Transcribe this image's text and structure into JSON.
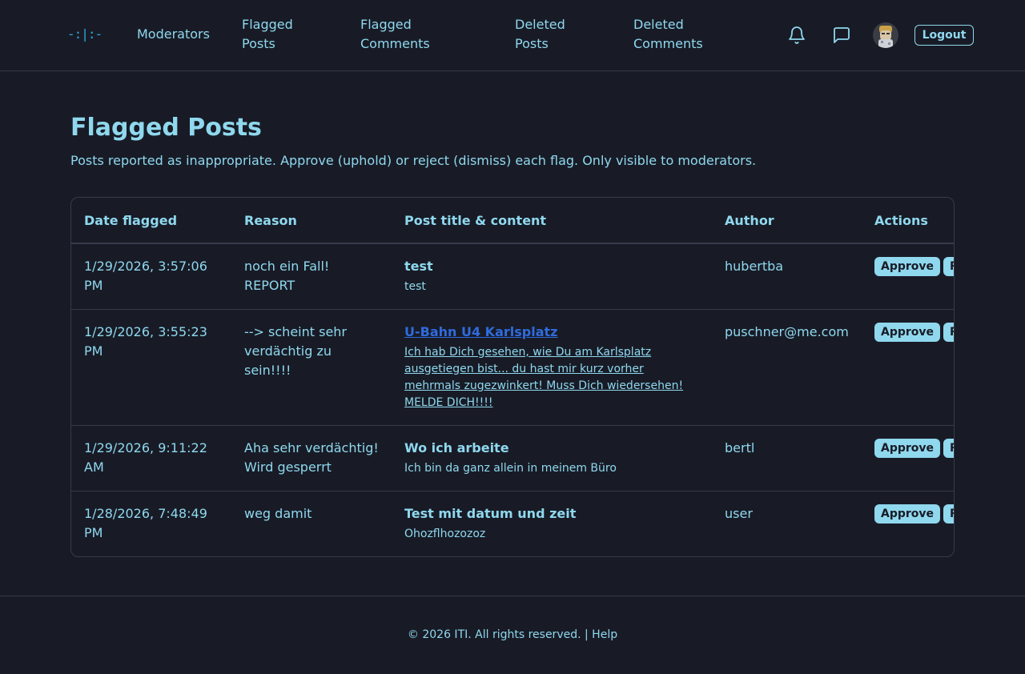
{
  "header": {
    "logo": "-:|:-",
    "nav": {
      "moderators": "Moderators",
      "flagged_posts": "Flagged Posts",
      "flagged_comments": "Flagged Comments",
      "deleted_posts": "Deleted Posts",
      "deleted_comments": "Deleted Comments"
    },
    "icons": {
      "notifications": "bell-icon",
      "messages": "chat-icon"
    },
    "logout_label": "Logout"
  },
  "main": {
    "title": "Flagged Posts",
    "description": "Posts reported as inappropriate. Approve (uphold) or reject (dismiss) each flag. Only visible to moderators.",
    "columns": {
      "date": "Date flagged",
      "reason": "Reason",
      "post": "Post title & content",
      "author": "Author",
      "actions": "Actions"
    },
    "rows": [
      {
        "date": "1/29/2026, 3:57:06 PM",
        "reason": "noch ein Fall! REPORT",
        "post_title": "test",
        "post_content": "test",
        "author": "hubertba",
        "approve_label": "Approve",
        "reject_label": "Reject"
      },
      {
        "date": "1/29/2026, 3:55:23 PM",
        "reason": "--> scheint sehr verdächtig zu sein!!!!",
        "post_title": "U-Bahn U4 Karlsplatz",
        "post_content": "Ich hab Dich gesehen, wie Du am Karlsplatz ausgetiegen bist... du hast mir kurz vorher mehrmals zugezwinkert! Muss Dich wiedersehen! MELDE DICH!!!!",
        "author": "puschner@me.com",
        "approve_label": "Approve",
        "reject_label": "Reject"
      },
      {
        "date": "1/29/2026, 9:11:22 AM",
        "reason": "Aha sehr verdächtig! Wird gesperrt",
        "post_title": "Wo ich arbeite",
        "post_content": "Ich bin da ganz allein in meinem Büro",
        "author": "bertl",
        "approve_label": "Approve",
        "reject_label": "Reject"
      },
      {
        "date": "1/28/2026, 7:48:49 PM",
        "reason": "weg damit",
        "post_title": "Test mit datum und zeit",
        "post_content": "Ohozflhozozoz",
        "author": "user",
        "approve_label": "Approve",
        "reject_label": "Reject"
      }
    ]
  },
  "footer": {
    "copyright": "© 2026 ITI. All rights reserved. |",
    "help": "Help"
  },
  "colors": {
    "background": "#181b26",
    "text": "#8fd8ee",
    "border": "#363b49",
    "link": "#2f6bdd",
    "logo": "#2fa8d8"
  }
}
